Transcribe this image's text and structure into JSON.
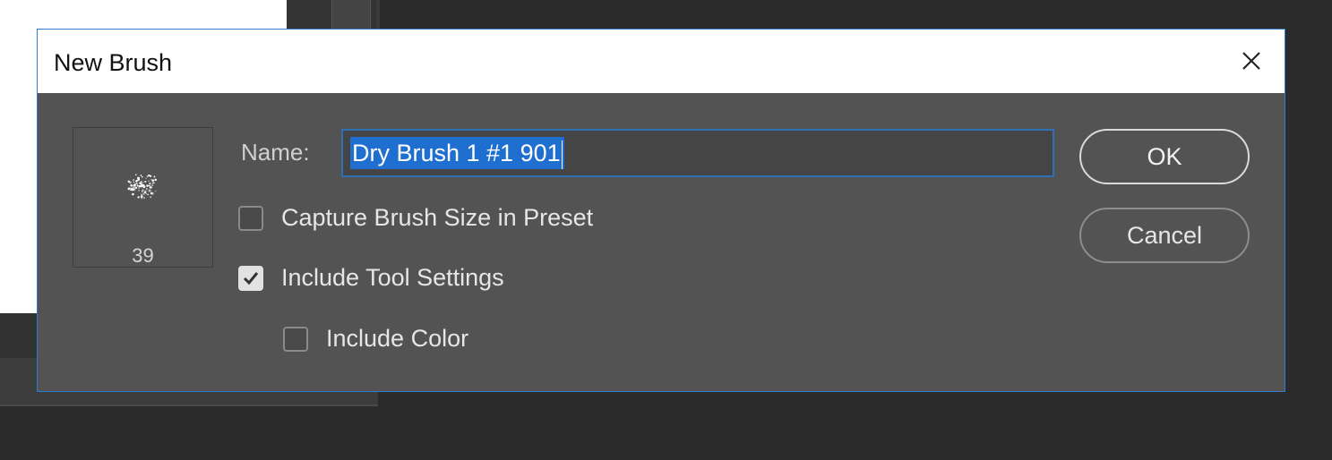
{
  "dialog": {
    "title": "New Brush",
    "close_icon": "close-icon",
    "accent_color": "#2e7bd0"
  },
  "preview": {
    "size": "39",
    "icon": "brush-tip-preview"
  },
  "name_field": {
    "label": "Name:",
    "value": "Dry Brush 1 #1 901",
    "selected": true
  },
  "options": {
    "capture_size": {
      "label": "Capture Brush Size in Preset",
      "checked": false
    },
    "include_tool_settings": {
      "label": "Include Tool Settings",
      "checked": true
    },
    "include_color": {
      "label": "Include Color",
      "checked": false
    }
  },
  "buttons": {
    "ok": "OK",
    "cancel": "Cancel"
  }
}
